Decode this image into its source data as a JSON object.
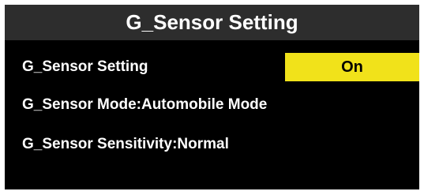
{
  "title": "G_Sensor Setting",
  "menu": {
    "items": [
      {
        "label": "G_Sensor Setting",
        "value": "On",
        "highlight_color": "#f1e21a"
      },
      {
        "label": "G_Sensor Mode:Automobile Mode"
      },
      {
        "label": "G_Sensor Sensitivity:Normal"
      }
    ]
  },
  "colors": {
    "background": "#000000",
    "title_bar": "#2d2d2d",
    "text": "#ffffff",
    "selected_value_bg": "#f1e21a",
    "selected_value_text": "#000000"
  }
}
